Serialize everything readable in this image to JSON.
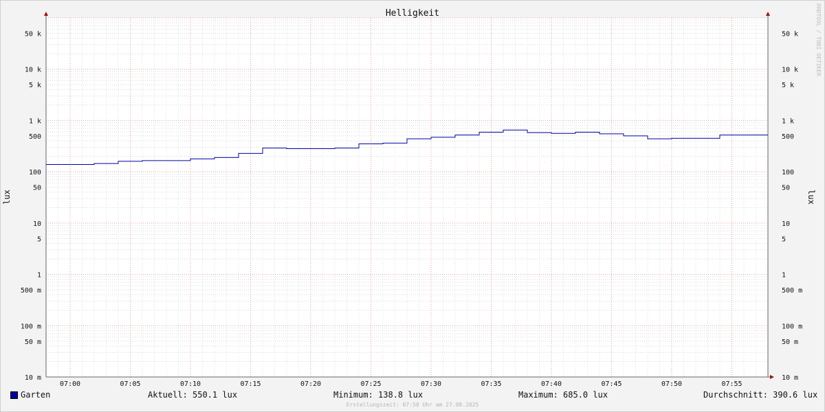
{
  "chart_data": {
    "type": "line",
    "title": "Helligkeit",
    "ylabel": "lux",
    "ylabel_right": "lux",
    "yscale": "log",
    "ylim": [
      0.01,
      100000
    ],
    "y_ticks": [
      {
        "value": 50000,
        "label": "50 k"
      },
      {
        "value": 10000,
        "label": "10 k"
      },
      {
        "value": 5000,
        "label": "5 k"
      },
      {
        "value": 1000,
        "label": "1 k"
      },
      {
        "value": 500,
        "label": "500"
      },
      {
        "value": 100,
        "label": "100"
      },
      {
        "value": 50,
        "label": "50"
      },
      {
        "value": 10,
        "label": "10"
      },
      {
        "value": 5,
        "label": "5"
      },
      {
        "value": 1,
        "label": "1"
      },
      {
        "value": 0.5,
        "label": "500 m"
      },
      {
        "value": 0.1,
        "label": "100 m"
      },
      {
        "value": 0.05,
        "label": "50 m"
      },
      {
        "value": 0.01,
        "label": "10 m"
      }
    ],
    "x_ticks": [
      "07:00",
      "07:05",
      "07:10",
      "07:15",
      "07:20",
      "07:25",
      "07:30",
      "07:35",
      "07:40",
      "07:45",
      "07:50",
      "07:55"
    ],
    "grid": true,
    "series": [
      {
        "name": "Garten",
        "color": "#0000a0",
        "x": [
          "06:58",
          "07:02",
          "07:04",
          "07:06",
          "07:10",
          "07:12",
          "07:14",
          "07:16",
          "07:18",
          "07:22",
          "07:24",
          "07:26",
          "07:28",
          "07:30",
          "07:32",
          "07:34",
          "07:36",
          "07:38",
          "07:40",
          "07:42",
          "07:44",
          "07:46",
          "07:48",
          "07:50",
          "07:54",
          "07:58"
        ],
        "values": [
          138.8,
          145,
          160,
          165,
          178,
          190,
          228,
          290,
          282,
          290,
          350,
          362,
          440,
          470,
          520,
          590,
          650,
          580,
          560,
          590,
          550,
          500,
          440,
          450,
          520,
          520
        ]
      }
    ],
    "credit": "RRDTOOL / TOBI OETIKER"
  },
  "legend": {
    "series_name": "Garten",
    "current": "Aktuell: 550.1 lux",
    "minimum": "Minimum: 138.8 lux",
    "maximum": "Maximum: 685.0 lux",
    "average": "Durchschnitt: 390.6 lux",
    "swatch_color": "#0000a0"
  },
  "footer": {
    "timestamp": "Erstellungszeit: 07:58 Uhr am 27.08.2025"
  }
}
